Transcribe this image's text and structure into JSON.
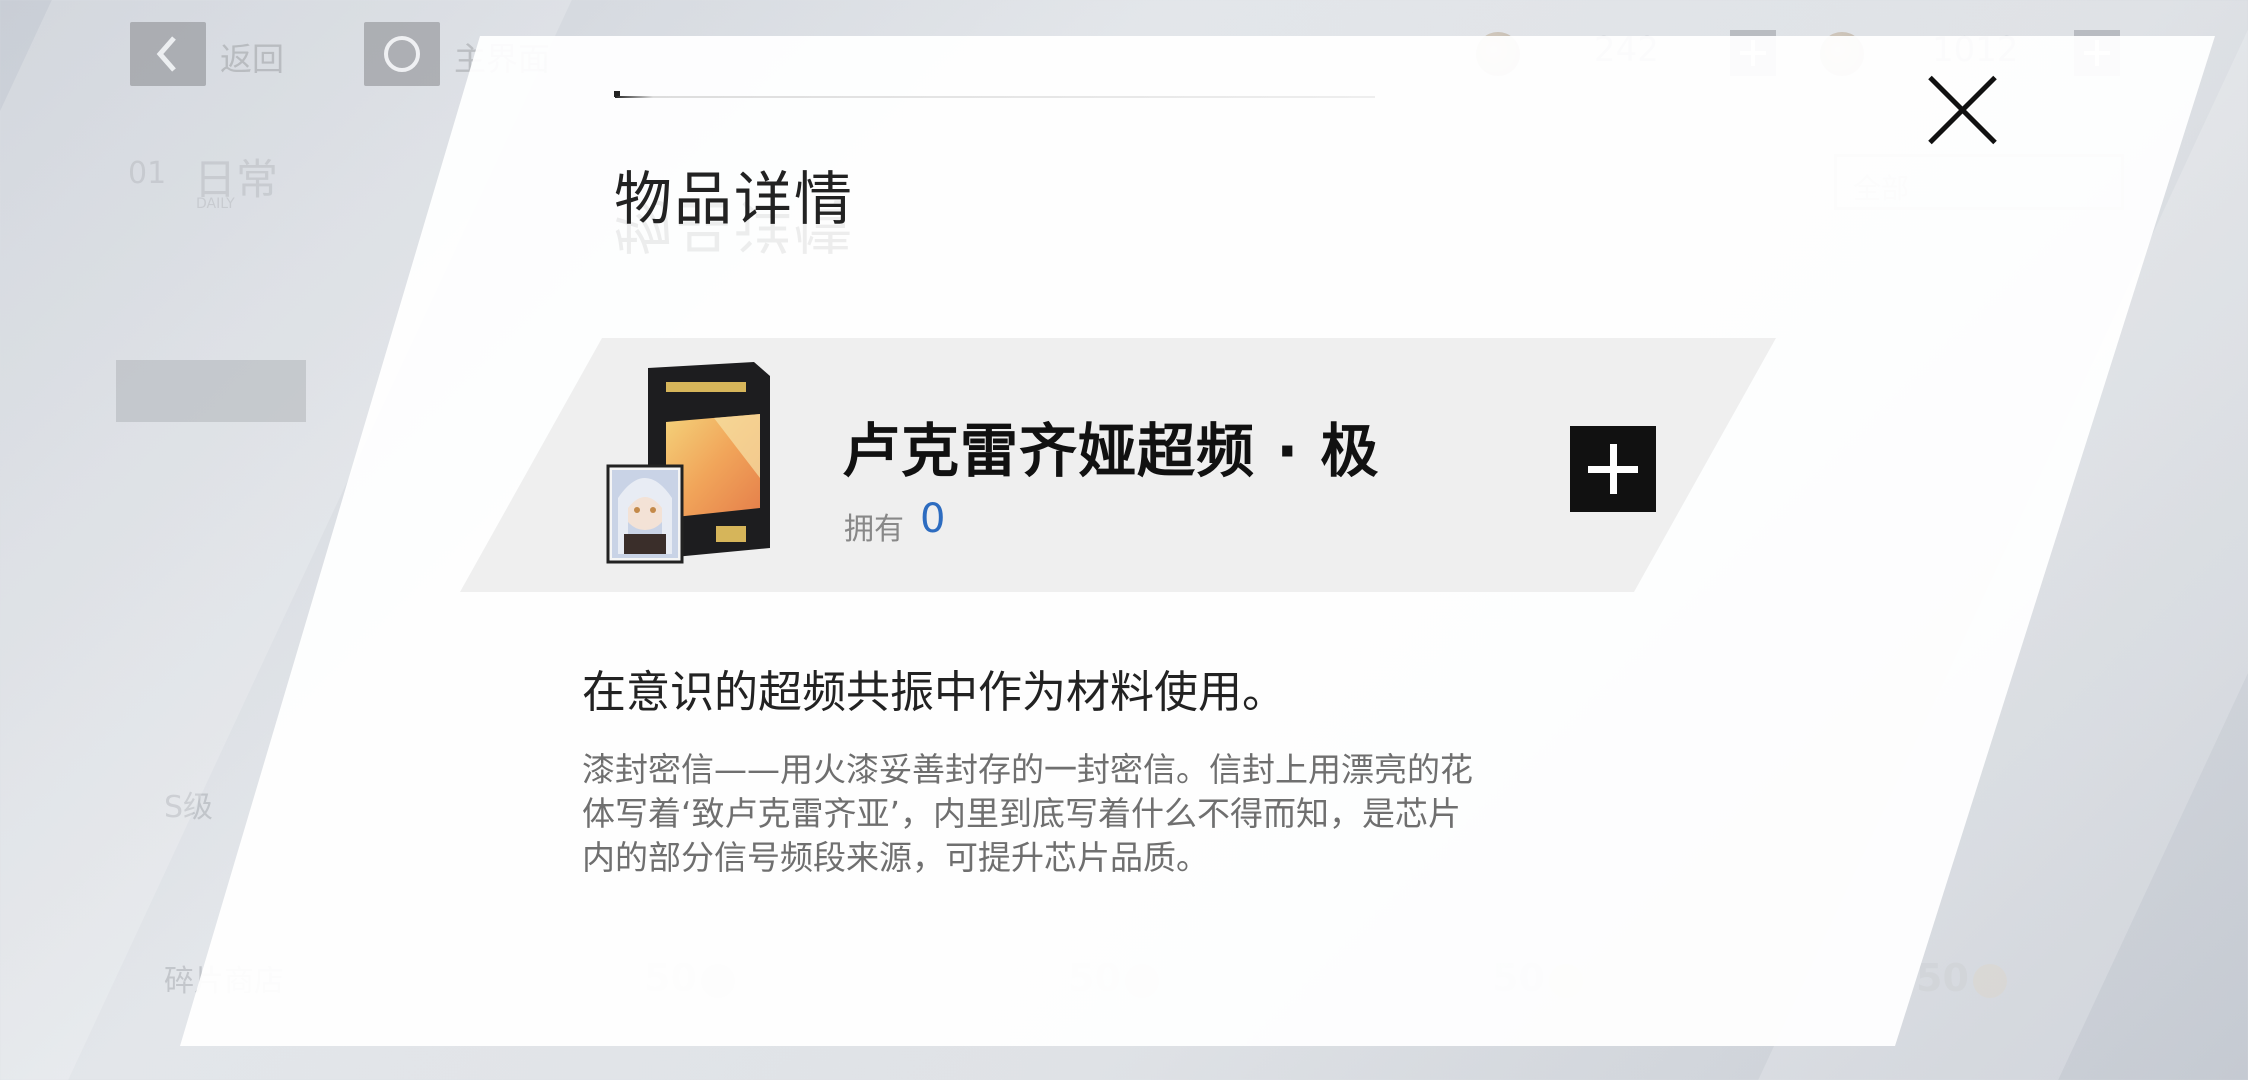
{
  "topbar": {
    "back_label": "返回",
    "home_label": "主界面",
    "currency1_value": "242",
    "currency2_value": "1012"
  },
  "background": {
    "tab_index": "01",
    "tab_label": "日常",
    "tab_sub": "DAILY",
    "filter_label": "全部",
    "shop_label": "碎片商店",
    "grade_label": "S级",
    "prices": [
      "50",
      "50",
      "50",
      "50"
    ]
  },
  "modal": {
    "title": "物品详情",
    "item": {
      "name": "卢克雷齐娅超频 · 极",
      "owned_label": "拥有",
      "owned_count": "0",
      "icon": "punishing-box-icon"
    },
    "usage": "在意识的超频共振中作为材料使用。",
    "description": "漆封密信——用火漆妥善封存的一封密信。信封上用漂亮的花体写着‘致卢克雷齐亚’，内里到底写着什么不得而知，是芯片内的部分信号频段来源，可提升芯片品质。"
  },
  "colors": {
    "accent_blue": "#2d6cc0",
    "button_black": "#111111"
  }
}
